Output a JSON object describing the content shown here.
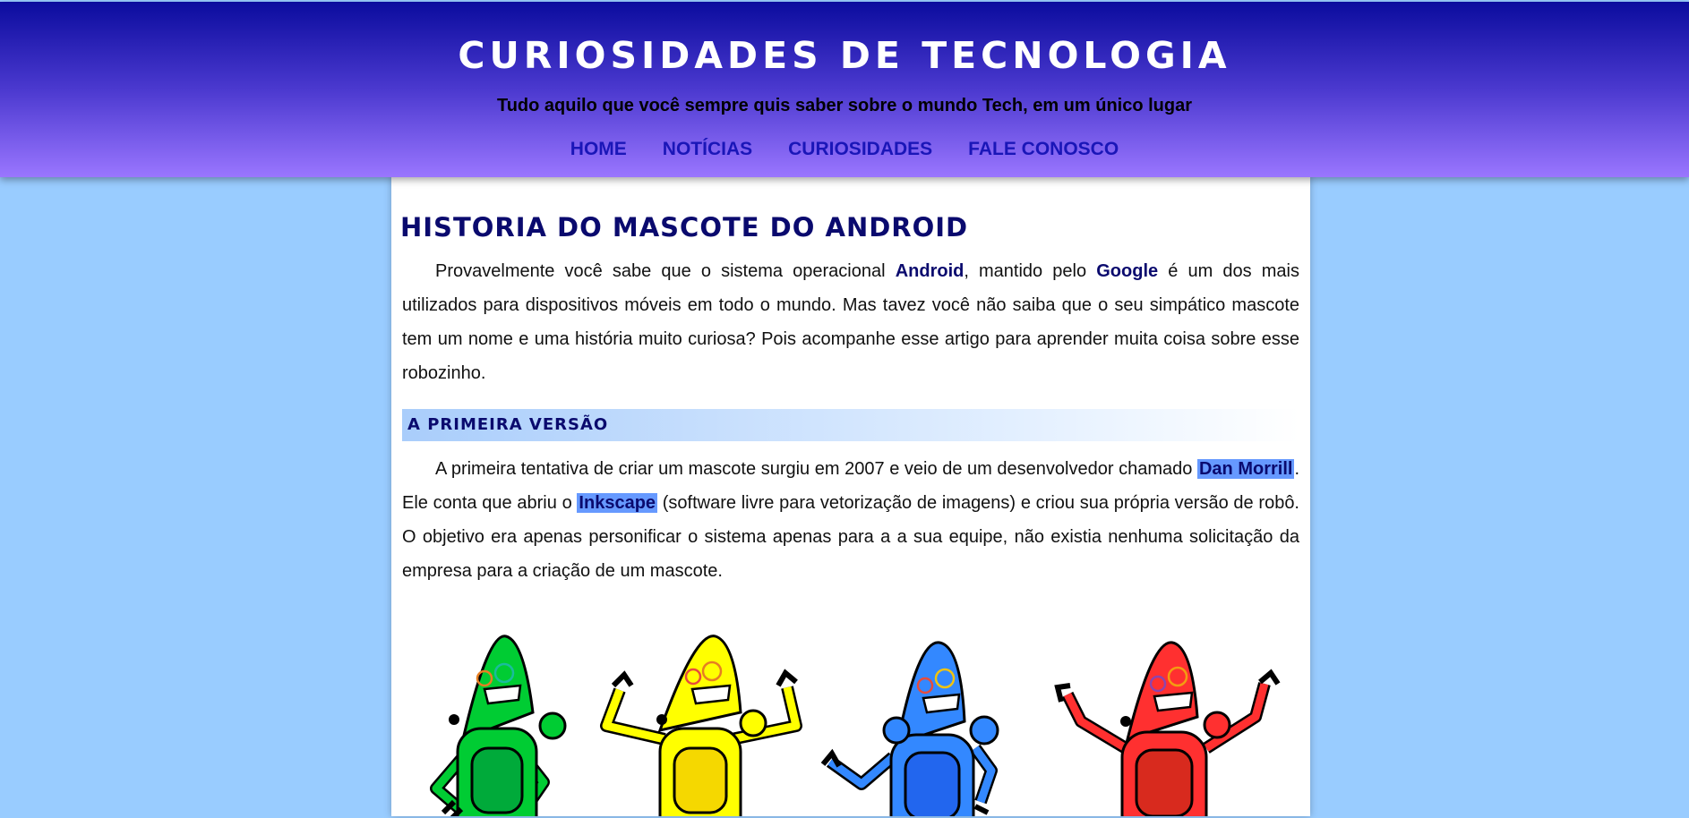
{
  "header": {
    "title": "Curiosidades de Tecnologia",
    "subtitle": "Tudo aquilo que você sempre quis saber sobre o mundo Tech, em um único lugar",
    "nav": [
      "HOME",
      "NOTÍCIAS",
      "CURIOSIDADES",
      "FALE CONOSCO"
    ]
  },
  "article": {
    "title": "Historia do Mascote do Android",
    "intro": {
      "t1": "Provavelmente você sabe que o sistema operacional ",
      "b1": "Android",
      "t2": ", mantido pelo ",
      "b2": "Google",
      "t3": " é um dos mais utilizados para dispositivos móveis em todo o mundo. Mas tavez você não saiba que o seu simpático mascote tem um nome e uma história muito curiosa? Pois acompanhe esse artigo para aprender muita coisa sobre esse robozinho."
    },
    "section1": {
      "heading": "A primeira versão",
      "t1": "A primeira tentativa de criar um mascote surgiu em 2007 e veio de um desenvolvedor chamado ",
      "h1": "Dan Morrill",
      "t2": ". Ele conta que abriu o ",
      "h2": "Inkscape",
      "t3": " (software livre para vetorização de imagens) e criou sua própria versão de robô. O objetivo era apenas personificar o sistema apenas para a a sua equipe, não existia nenhuma solicitação da empresa para a criação de um mascote."
    }
  },
  "illustration": {
    "robots": [
      {
        "name": "green-robot",
        "fill": "#00cc33",
        "body": "#00aa3a"
      },
      {
        "name": "yellow-robot",
        "fill": "#ffff00",
        "body": "#f5d800"
      },
      {
        "name": "blue-robot",
        "fill": "#3388ff",
        "body": "#2266ee"
      },
      {
        "name": "red-robot",
        "fill": "#ff3030",
        "body": "#d82a1e"
      }
    ]
  },
  "colors": {
    "page_bg": "#99ccff",
    "header_top": "#0b0c9e",
    "header_bottom": "#9a76ff",
    "nav_link": "#1a16b8",
    "heading": "#0a0a6e",
    "highlight": "#6699ff"
  }
}
